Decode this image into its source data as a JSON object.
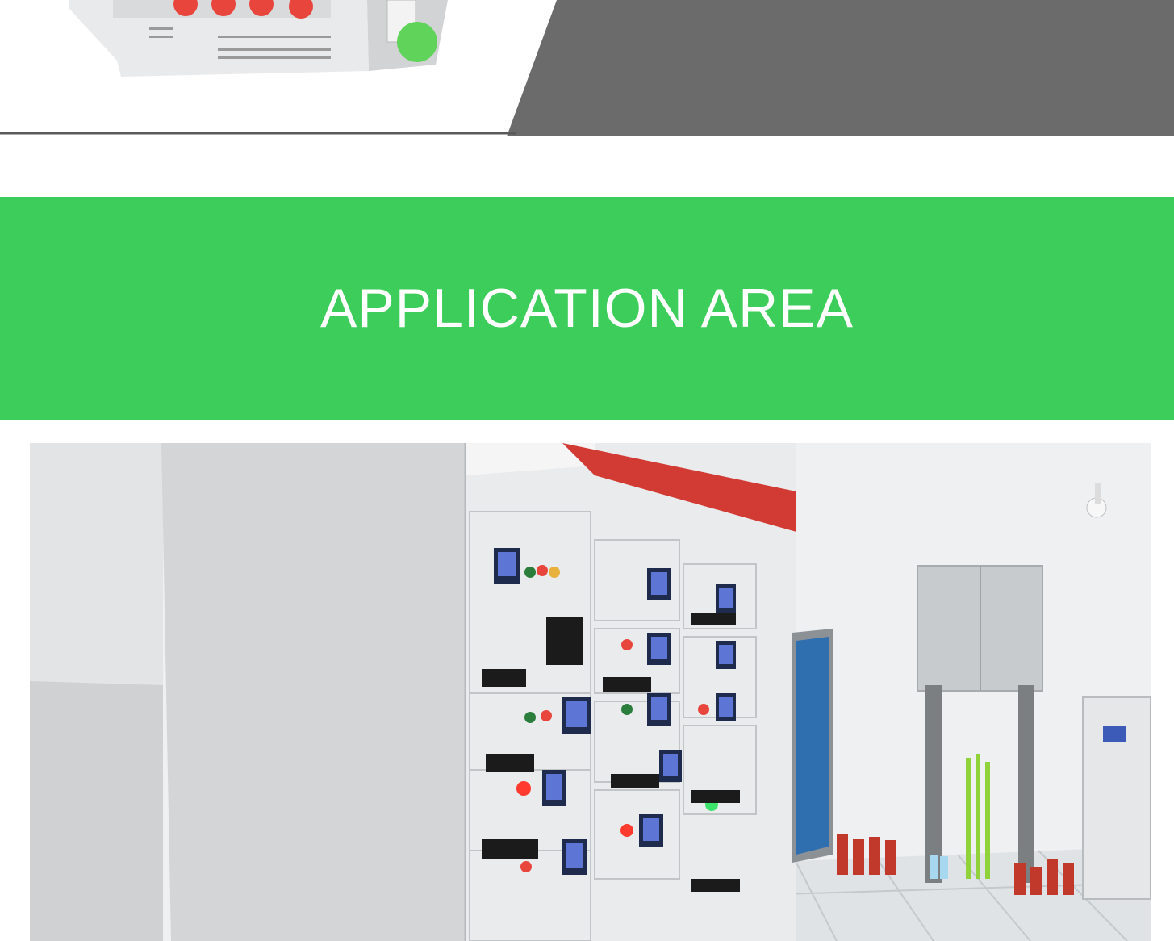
{
  "section": {
    "title": "APPLICATION AREA"
  },
  "colors": {
    "accent_green": "#3ccd5a",
    "banner_gray": "#6b6b6b",
    "button_red": "#e8453c",
    "cabinet_red": "#d23b33",
    "door_blue": "#2f6fb0"
  },
  "images": {
    "product": "product-meter-photo",
    "application": "switchgear-room-photo"
  }
}
